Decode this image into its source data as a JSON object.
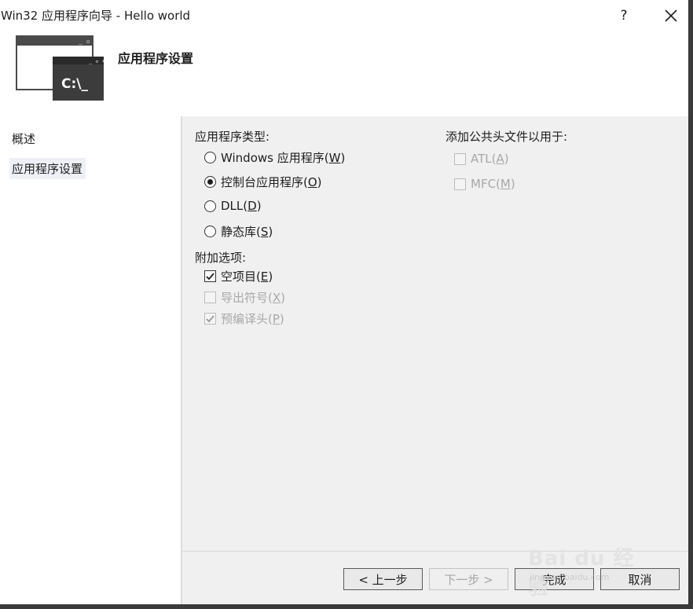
{
  "window": {
    "title": "Win32 应用程序向导 - Hello world",
    "help_label": "?",
    "close_icon": "close-icon"
  },
  "header": {
    "title": "应用程序设置",
    "icon_text": "C:\\_"
  },
  "nav": {
    "items": [
      {
        "label": "概述",
        "active": false
      },
      {
        "label": "应用程序设置",
        "active": true
      }
    ]
  },
  "app_type": {
    "label": "应用程序类型:",
    "options": [
      {
        "text": "Windows 应用程序(",
        "key": "W",
        "selected": false
      },
      {
        "text": "控制台应用程序(",
        "key": "O",
        "selected": true
      },
      {
        "text": "DLL(",
        "key": "D",
        "selected": false
      },
      {
        "text": "静态库(",
        "key": "S",
        "selected": false
      }
    ]
  },
  "extra_options": {
    "label": "附加选项:",
    "options": [
      {
        "text": "空项目(",
        "key": "E",
        "checked": true,
        "enabled": true
      },
      {
        "text": "导出符号(",
        "key": "X",
        "checked": false,
        "enabled": false
      },
      {
        "text": "预编译头(",
        "key": "P",
        "checked": true,
        "enabled": false
      }
    ]
  },
  "common_headers": {
    "label": "添加公共头文件以用于:",
    "options": [
      {
        "text": "ATL(",
        "key": "A",
        "checked": false,
        "enabled": false
      },
      {
        "text": "MFC(",
        "key": "M",
        "checked": false,
        "enabled": false
      }
    ]
  },
  "buttons": {
    "prev": "< 上一步",
    "next": "下一步 >",
    "finish": "完成",
    "cancel": "取消"
  },
  "watermark": {
    "brand": "Bai du 经验",
    "url": "jingyan.baidu.com"
  },
  "colors": {
    "window_bg": "#ffffff",
    "panel_bg": "#f0f0f0",
    "disabled_text": "#a8a8a8"
  }
}
